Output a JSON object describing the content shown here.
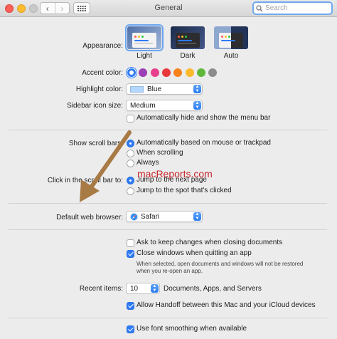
{
  "window": {
    "title": "General"
  },
  "search": {
    "placeholder": "Search"
  },
  "appearance": {
    "label": "Appearance:",
    "options": [
      {
        "label": "Light",
        "selected": true
      },
      {
        "label": "Dark",
        "selected": false
      },
      {
        "label": "Auto",
        "selected": false
      }
    ]
  },
  "accent_color": {
    "label": "Accent color:",
    "colors": [
      "#2f7bf6",
      "#9a3fb5",
      "#e83f8d",
      "#e8383b",
      "#f7821b",
      "#fbb92e",
      "#5fb83c",
      "#8c8c8c"
    ],
    "selected_index": 0
  },
  "highlight_color": {
    "label": "Highlight color:",
    "value": "Blue",
    "swatch": "#b3d7ff"
  },
  "sidebar_icon_size": {
    "label": "Sidebar icon size:",
    "value": "Medium"
  },
  "auto_hide_menu_bar": {
    "label": "Automatically hide and show the menu bar",
    "checked": false
  },
  "show_scroll_bars": {
    "label": "Show scroll bars:",
    "options": [
      {
        "label": "Automatically based on mouse or trackpad",
        "selected": true
      },
      {
        "label": "When scrolling",
        "selected": false
      },
      {
        "label": "Always",
        "selected": false
      }
    ]
  },
  "click_scroll_bar": {
    "label": "Click in the scroll bar to:",
    "options": [
      {
        "label": "Jump to the next page",
        "selected": true
      },
      {
        "label": "Jump to the spot that's clicked",
        "selected": false
      }
    ]
  },
  "watermark": "macReports.com",
  "default_browser": {
    "label": "Default web browser:",
    "value": "Safari"
  },
  "ask_keep_changes": {
    "label": "Ask to keep changes when closing documents",
    "checked": false
  },
  "close_windows": {
    "label": "Close windows when quitting an app",
    "checked": true,
    "note_line1": "When selected, open documents and windows will not be restored",
    "note_line2": "when you re-open an app."
  },
  "recent_items": {
    "label": "Recent items:",
    "value": "10",
    "suffix": "Documents, Apps, and Servers"
  },
  "handoff": {
    "label": "Allow Handoff between this Mac and your iCloud devices",
    "checked": true
  },
  "font_smoothing": {
    "label": "Use font smoothing when available",
    "checked": true
  },
  "colors": {
    "accent": "#2f7bf6",
    "arrow": "#a87a45",
    "watermark": "#c8262d"
  }
}
